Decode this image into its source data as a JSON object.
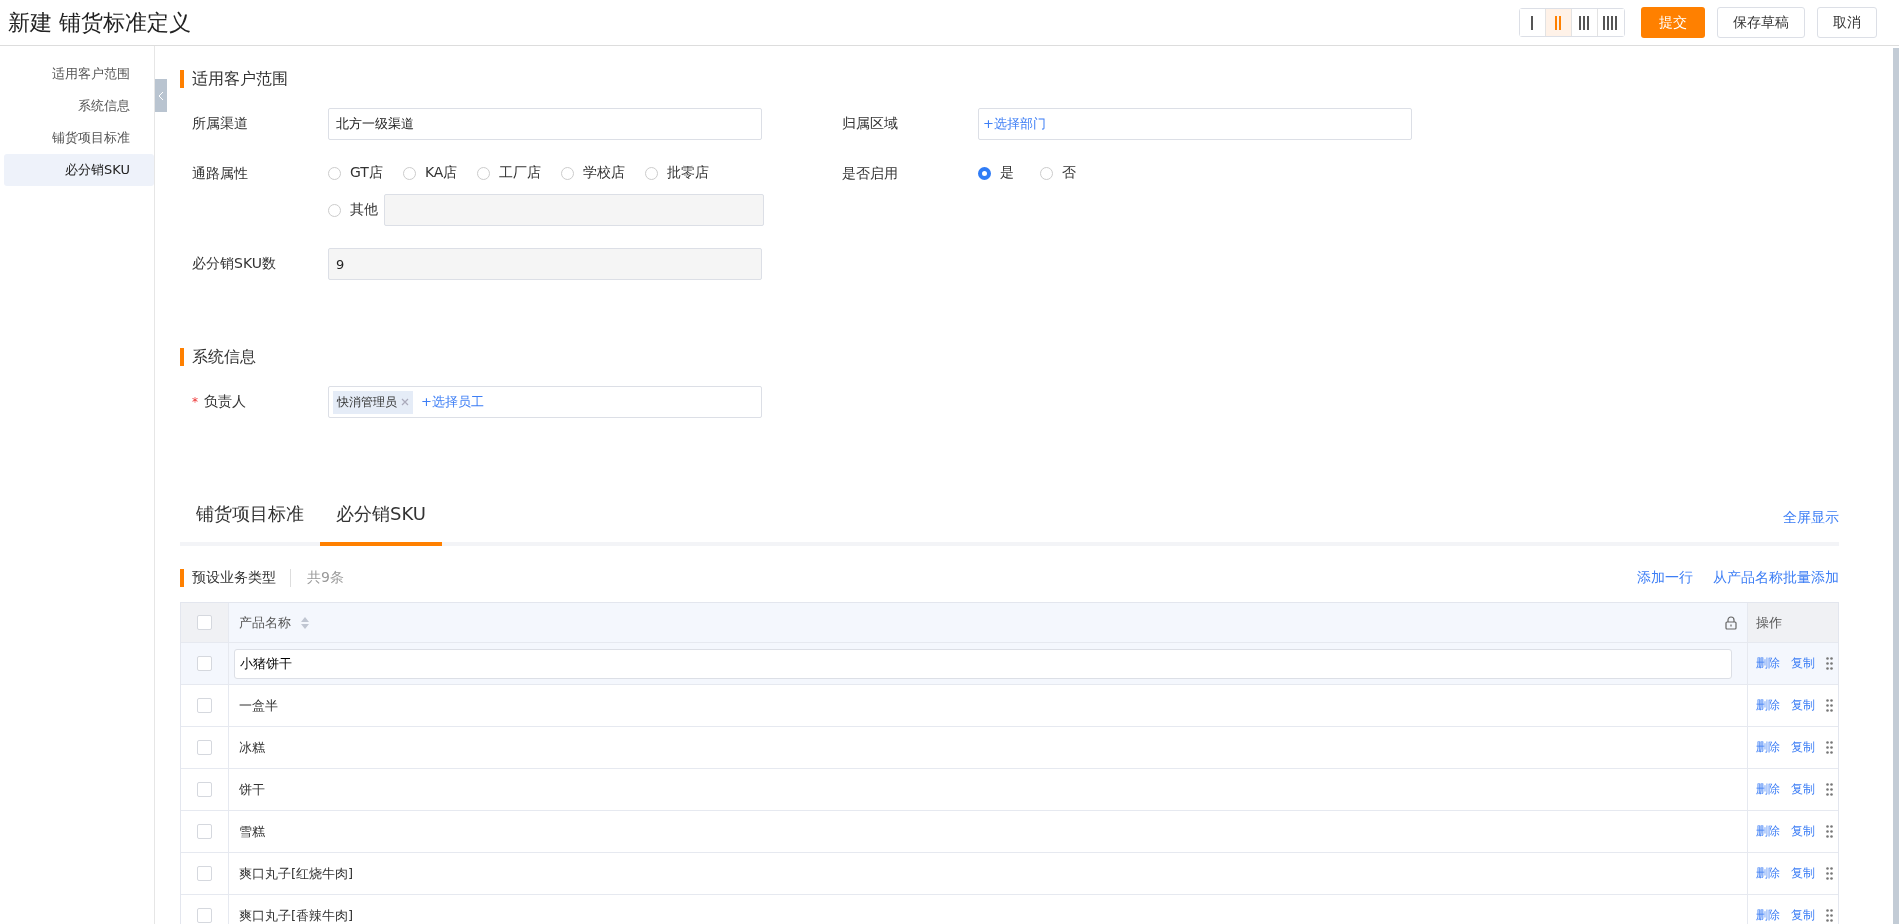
{
  "header": {
    "title": "新建 铺货标准定义",
    "layout_options": [
      {
        "selected": false
      },
      {
        "selected": true
      },
      {
        "selected": false
      },
      {
        "selected": false
      }
    ],
    "buttons": [
      {
        "label": "提交",
        "kind": "primary"
      },
      {
        "label": "保存草稿",
        "kind": "default"
      },
      {
        "label": "取消",
        "kind": "default"
      }
    ]
  },
  "sidebar": {
    "items": [
      {
        "label": "适用客户范围",
        "selected": false
      },
      {
        "label": "系统信息",
        "selected": false
      },
      {
        "label": "铺货项目标准",
        "selected": false
      },
      {
        "label": "必分销SKU",
        "selected": true
      }
    ]
  },
  "scope_section": {
    "title": "适用客户范围",
    "channel": {
      "label": "所属渠道",
      "value": "北方一级渠道"
    },
    "region": {
      "label": "归属区域",
      "link": "+选择部门"
    },
    "route": {
      "label": "通路属性",
      "options": [
        {
          "label": "GT店",
          "selected": false
        },
        {
          "label": "KA店",
          "selected": false
        },
        {
          "label": "工厂店",
          "selected": false
        },
        {
          "label": "学校店",
          "selected": false
        },
        {
          "label": "批零店",
          "selected": false
        }
      ],
      "other": {
        "label": "其他",
        "selected": false
      }
    },
    "enabled": {
      "label": "是否启用",
      "options": [
        {
          "label": "是",
          "selected": true
        },
        {
          "label": "否",
          "selected": false
        }
      ]
    },
    "sku_count": {
      "label": "必分销SKU数",
      "value": "9"
    }
  },
  "system_section": {
    "title": "系统信息",
    "owner": {
      "label": "负责人",
      "required_mark": "*",
      "tags": [
        "快消管理员"
      ],
      "link": "+选择员工"
    }
  },
  "tabs": {
    "items": [
      {
        "label": "铺货项目标准",
        "selected": false
      },
      {
        "label": "必分销SKU",
        "selected": true
      }
    ],
    "fullscreen": "全屏显示"
  },
  "table": {
    "title": "预设业务类型",
    "count": "共9条",
    "actions": [
      "添加一行",
      "从产品名称批量添加"
    ],
    "header_checked": false,
    "columns": [
      "产品名称",
      "操作"
    ],
    "rows": [
      {
        "name": "小猪饼干",
        "kind": "input",
        "checked": false,
        "delete": "删除",
        "copy": "复制"
      },
      {
        "name": "一盒半",
        "kind": "text",
        "checked": false,
        "delete": "删除",
        "copy": "复制"
      },
      {
        "name": "冰糕",
        "kind": "text",
        "checked": false,
        "delete": "删除",
        "copy": "复制"
      },
      {
        "name": "饼干",
        "kind": "text",
        "checked": false,
        "delete": "删除",
        "copy": "复制"
      },
      {
        "name": "雪糕",
        "kind": "text",
        "checked": false,
        "delete": "删除",
        "copy": "复制"
      },
      {
        "name": "爽口丸子[红烧牛肉]",
        "kind": "text",
        "checked": false,
        "delete": "删除",
        "copy": "复制"
      },
      {
        "name": "爽口丸子[香辣牛肉]",
        "kind": "text",
        "checked": false,
        "delete": "删除",
        "copy": "复制"
      }
    ]
  }
}
